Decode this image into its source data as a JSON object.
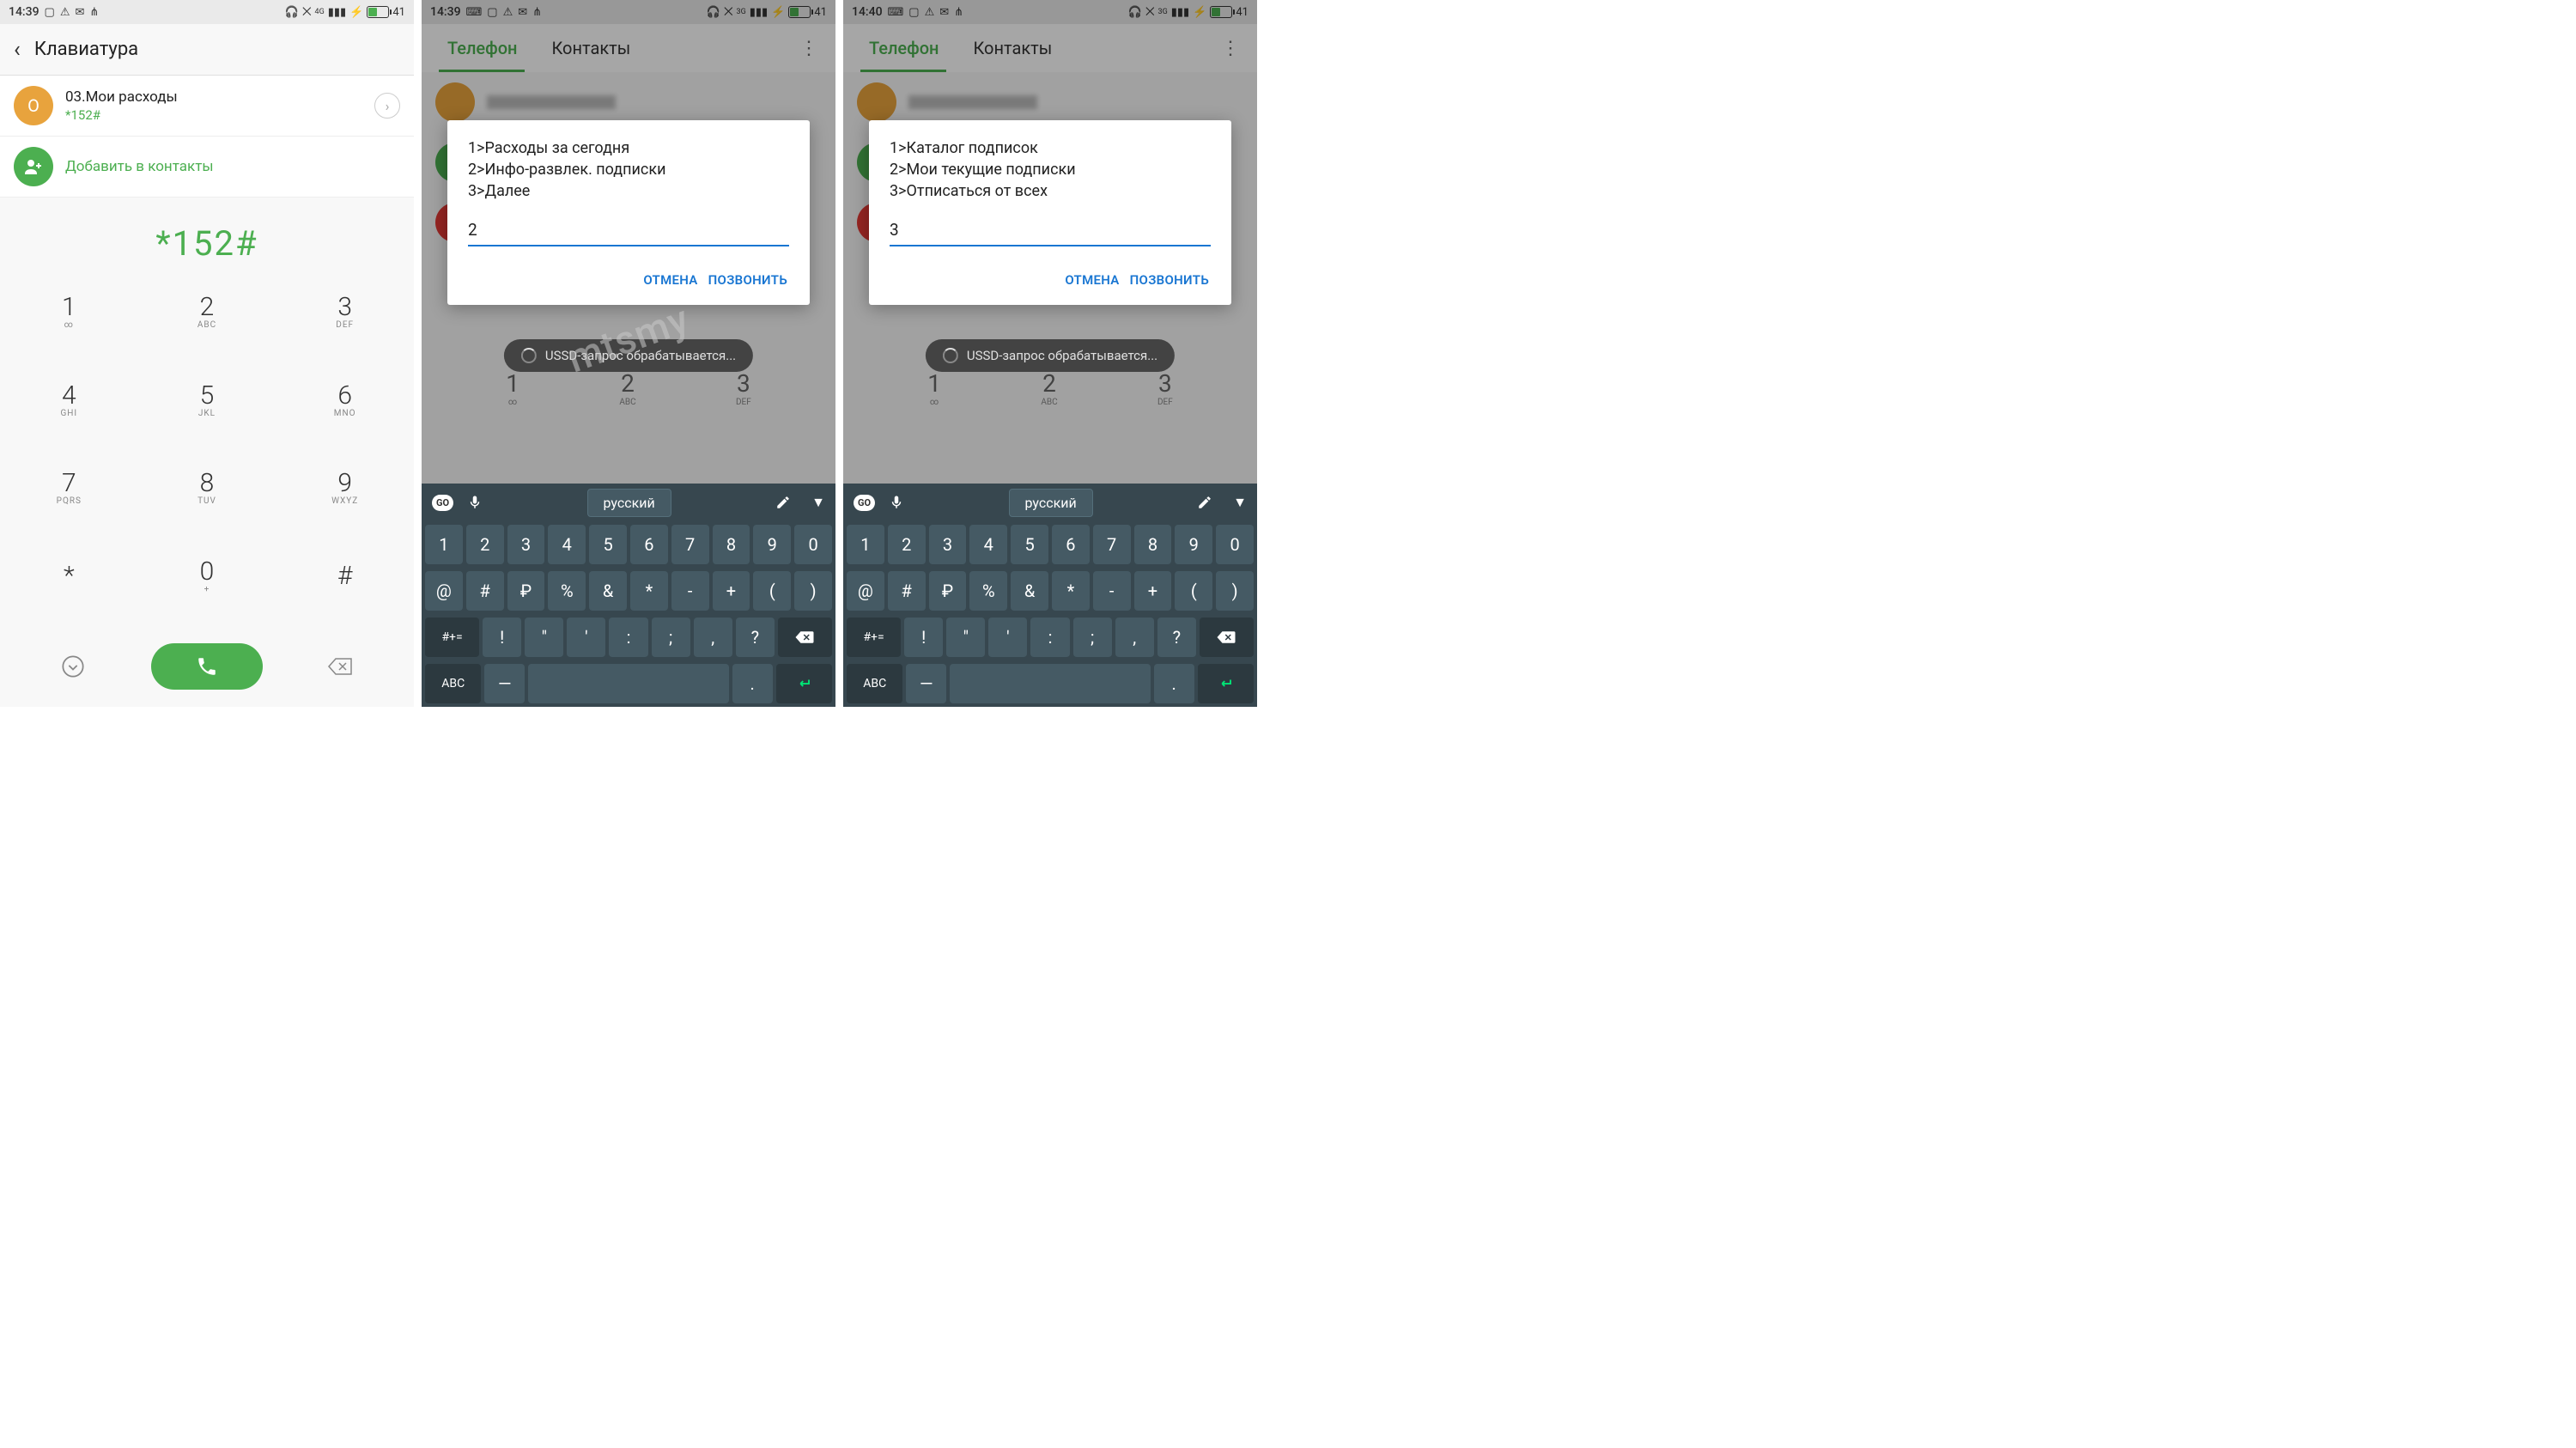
{
  "status": {
    "time1": "14:39",
    "time2": "14:39",
    "time3": "14:40",
    "battery": "41",
    "net1": "4G",
    "net2": "3G"
  },
  "screen1": {
    "header": "Клавиатура",
    "contact_name": "03.Мои расходы",
    "contact_code": "*152#",
    "contact_avatar": "O",
    "add_contacts": "Добавить в контакты",
    "dialed": "*152#",
    "keys": [
      {
        "n": "1",
        "s": "∞"
      },
      {
        "n": "2",
        "s": "ABC"
      },
      {
        "n": "3",
        "s": "DEF"
      },
      {
        "n": "4",
        "s": "GHI"
      },
      {
        "n": "5",
        "s": "JKL"
      },
      {
        "n": "6",
        "s": "MNO"
      },
      {
        "n": "7",
        "s": "PQRS"
      },
      {
        "n": "8",
        "s": "TUV"
      },
      {
        "n": "9",
        "s": "WXYZ"
      },
      {
        "n": "*",
        "s": ""
      },
      {
        "n": "0",
        "s": "+"
      },
      {
        "n": "#",
        "s": ""
      }
    ]
  },
  "phoneapp": {
    "tab_phone": "Телефон",
    "tab_contacts": "Контакты",
    "toast": "USSD-запрос обрабатывается...",
    "bg_keys": [
      {
        "n": "1",
        "s": "∞"
      },
      {
        "n": "2",
        "s": "ABC"
      },
      {
        "n": "3",
        "s": "DEF"
      }
    ]
  },
  "dialog2": {
    "line1": "1>Расходы за сегодня",
    "line2": "2>Инфо-развлек. подписки",
    "line3": "3>Далее",
    "input": "2",
    "cancel": "ОТМЕНА",
    "call": "ПОЗВОНИТЬ"
  },
  "dialog3": {
    "line1": "1>Каталог подписок",
    "line2": "2>Мои текущие подписки",
    "line3": "3>Отписаться от всех",
    "input": "3",
    "cancel": "ОТМЕНА",
    "call": "ПОЗВОНИТЬ"
  },
  "keyboard": {
    "go": "GO",
    "lang": "русский",
    "row1": [
      "1",
      "2",
      "3",
      "4",
      "5",
      "6",
      "7",
      "8",
      "9",
      "0"
    ],
    "row2": [
      "@",
      "#",
      "₽",
      "%",
      "&",
      "*",
      "-",
      "+",
      "(",
      ")"
    ],
    "sym": "#+=",
    "row3": [
      "!",
      "\"",
      "'",
      ":",
      ";",
      ",",
      "?"
    ],
    "abc": "ABC",
    "dot": "."
  },
  "watermark": "mtsmy"
}
